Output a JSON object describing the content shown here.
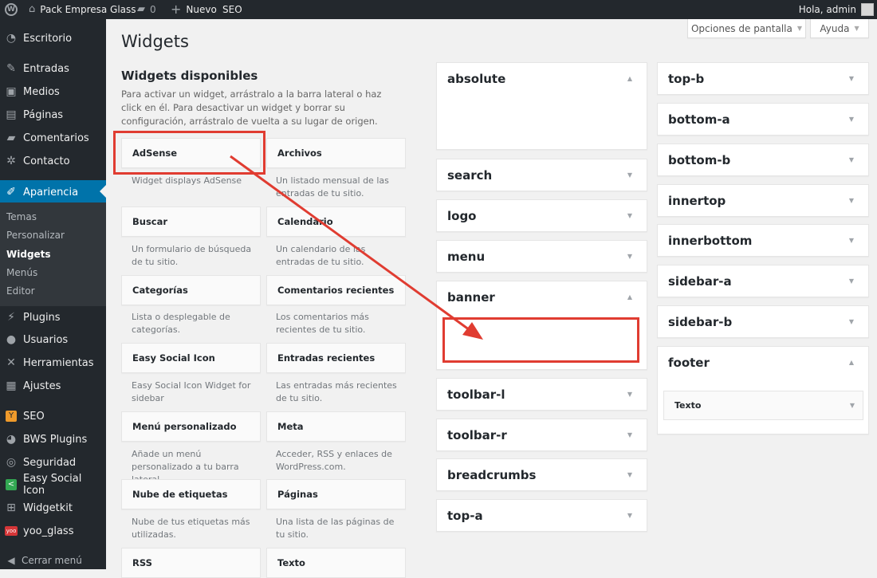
{
  "admin_bar": {
    "site_name": "Pack Empresa Glass",
    "comments_count": "0",
    "new_label": "Nuevo",
    "seo_label": "SEO",
    "greeting": "Hola, admin"
  },
  "sidebar": {
    "items": [
      {
        "label": "Escritorio",
        "icon": "dashboard-icon"
      },
      {
        "label": "Entradas",
        "icon": "pin-icon"
      },
      {
        "label": "Medios",
        "icon": "media-icon"
      },
      {
        "label": "Páginas",
        "icon": "pages-icon"
      },
      {
        "label": "Comentarios",
        "icon": "comments-icon"
      },
      {
        "label": "Contacto",
        "icon": "gear-icon"
      },
      {
        "label": "Apariencia",
        "icon": "brush-icon"
      },
      {
        "label": "Plugins",
        "icon": "plugin-icon"
      },
      {
        "label": "Usuarios",
        "icon": "user-icon"
      },
      {
        "label": "Herramientas",
        "icon": "wrench-icon"
      },
      {
        "label": "Ajustes",
        "icon": "settings-icon"
      },
      {
        "label": "SEO",
        "icon": "seo-icon"
      },
      {
        "label": "BWS Plugins",
        "icon": "bws-icon"
      },
      {
        "label": "Seguridad",
        "icon": "shield-icon"
      },
      {
        "label": "Easy Social Icon",
        "icon": "share-icon"
      },
      {
        "label": "Widgetkit",
        "icon": "widgetkit-icon"
      },
      {
        "label": "yoo_glass",
        "icon": "yoo-icon"
      }
    ],
    "submenu": [
      "Temas",
      "Personalizar",
      "Widgets",
      "Menús",
      "Editor"
    ],
    "collapse_label": "Cerrar menú"
  },
  "screen_meta": {
    "options_label": "Opciones de pantalla",
    "help_label": "Ayuda"
  },
  "page": {
    "title": "Widgets",
    "available_title": "Widgets disponibles",
    "available_desc": "Para activar un widget, arrástralo a la barra lateral o haz click en él. Para desactivar un widget y borrar su configuración, arrástralo de vuelta a su lugar de origen."
  },
  "available_widgets": [
    {
      "name": "AdSense",
      "desc": "Widget displays AdSense"
    },
    {
      "name": "Archivos",
      "desc": "Un listado mensual de las entradas de tu sitio."
    },
    {
      "name": "Buscar",
      "desc": "Un formulario de búsqueda de tu sitio."
    },
    {
      "name": "Calendario",
      "desc": "Un calendario de las entradas de tu sitio."
    },
    {
      "name": "Categorías",
      "desc": "Lista o desplegable de categorías."
    },
    {
      "name": "Comentarios recientes",
      "desc": "Los comentarios más recientes de tu sitio."
    },
    {
      "name": "Easy Social Icon",
      "desc": "Easy Social Icon Widget for sidebar"
    },
    {
      "name": "Entradas recientes",
      "desc": "Las entradas más recientes de tu sitio."
    },
    {
      "name": "Menú personalizado",
      "desc": "Añade un menú personalizado a tu barra lateral."
    },
    {
      "name": "Meta",
      "desc": "Acceder, RSS y enlaces de WordPress.com."
    },
    {
      "name": "Nube de etiquetas",
      "desc": "Nube de tus etiquetas más utilizadas."
    },
    {
      "name": "Páginas",
      "desc": "Una lista de las páginas de tu sitio."
    },
    {
      "name": "RSS",
      "desc": ""
    },
    {
      "name": "Texto",
      "desc": ""
    }
  ],
  "sidebar_areas_col1": [
    {
      "title": "absolute",
      "toggle": "▲"
    },
    {
      "title": "search",
      "toggle": "▼"
    },
    {
      "title": "logo",
      "toggle": "▼"
    },
    {
      "title": "menu",
      "toggle": "▼"
    },
    {
      "title": "banner",
      "toggle": "▲"
    },
    {
      "title": "toolbar-l",
      "toggle": "▼"
    },
    {
      "title": "toolbar-r",
      "toggle": "▼"
    },
    {
      "title": "breadcrumbs",
      "toggle": "▼"
    },
    {
      "title": "top-a",
      "toggle": "▼"
    }
  ],
  "sidebar_areas_col2": [
    {
      "title": "top-b",
      "toggle": "▼"
    },
    {
      "title": "bottom-a",
      "toggle": "▼"
    },
    {
      "title": "bottom-b",
      "toggle": "▼"
    },
    {
      "title": "innertop",
      "toggle": "▼"
    },
    {
      "title": "innerbottom",
      "toggle": "▼"
    },
    {
      "title": "sidebar-a",
      "toggle": "▼"
    },
    {
      "title": "sidebar-b",
      "toggle": "▼"
    },
    {
      "title": "footer",
      "toggle": "▲"
    }
  ],
  "footer_widget": {
    "name": "Texto",
    "toggle": "▼"
  },
  "colors": {
    "adminbar": "#23282d",
    "active_menu": "#0073aa",
    "annotation": "#e03c31"
  }
}
